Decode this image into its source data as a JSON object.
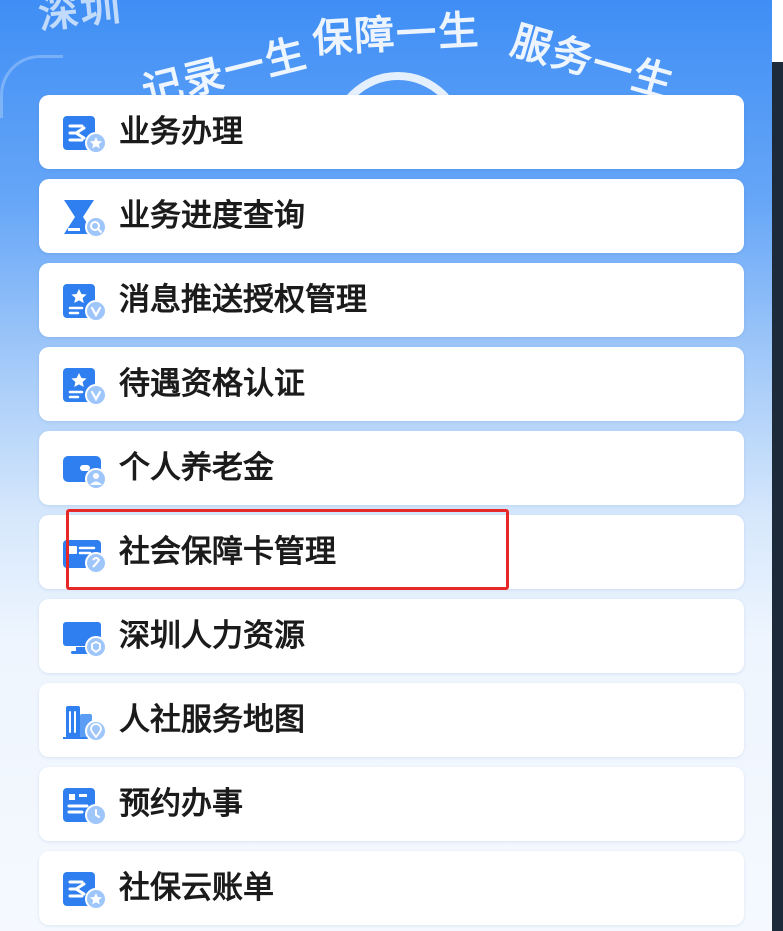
{
  "banner": {
    "words": [
      "深圳",
      "记录一生",
      "保障一生",
      "服务一生"
    ]
  },
  "menu": {
    "items": [
      {
        "label": "业务办理",
        "icon": "document-star-icon"
      },
      {
        "label": "业务进度查询",
        "icon": "hourglass-search-icon"
      },
      {
        "label": "消息推送授权管理",
        "icon": "badge-verified-icon"
      },
      {
        "label": "待遇资格认证",
        "icon": "badge-verified-icon"
      },
      {
        "label": "个人养老金",
        "icon": "wallet-user-icon"
      },
      {
        "label": "社会保障卡管理",
        "icon": "social-security-card-icon"
      },
      {
        "label": "深圳人力资源",
        "icon": "monitor-icon"
      },
      {
        "label": "人社服务地图",
        "icon": "building-location-icon"
      },
      {
        "label": "预约办事",
        "icon": "calendar-clock-icon"
      },
      {
        "label": "社保云账单",
        "icon": "document-star-icon"
      }
    ]
  },
  "colors": {
    "accent": "#3f8ef5",
    "icon_primary": "#2f7ff0",
    "icon_light": "#9fc6fb",
    "highlight": "#e62828"
  }
}
